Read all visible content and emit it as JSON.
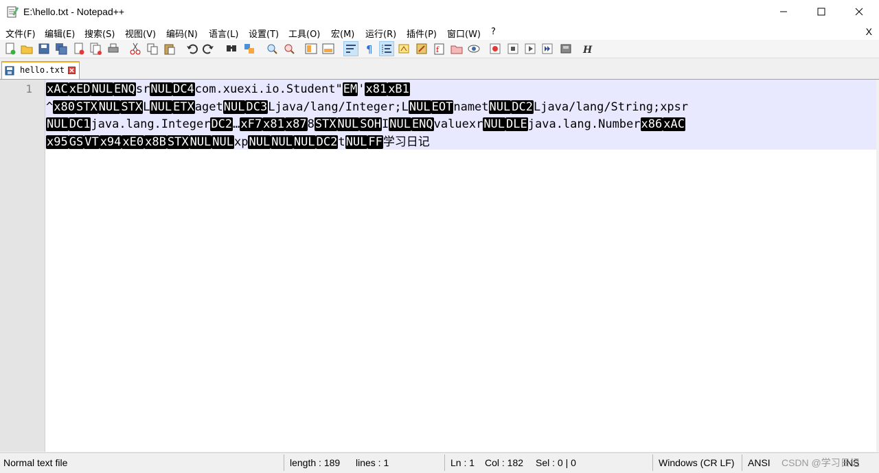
{
  "window": {
    "title": "E:\\hello.txt - Notepad++",
    "close_glyph": "X"
  },
  "menu": [
    "文件(F)",
    "编辑(E)",
    "搜索(S)",
    "视图(V)",
    "编码(N)",
    "语言(L)",
    "设置(T)",
    "工具(O)",
    "宏(M)",
    "运行(R)",
    "插件(P)",
    "窗口(W)",
    "?"
  ],
  "tab": {
    "label": "hello.txt"
  },
  "editor": {
    "line_number": "1",
    "lines": [
      [
        {
          "c": "xAC"
        },
        {
          "c": "xED"
        },
        {
          "c": "NUL"
        },
        {
          "c": "ENQ"
        },
        {
          "t": "sr"
        },
        {
          "c": "NUL"
        },
        {
          "c": "DC4"
        },
        {
          "t": "com.xuexi.io.Student\""
        },
        {
          "c": "EM"
        },
        {
          "t": "'"
        },
        {
          "c": "x81"
        },
        {
          "c": "xB1"
        }
      ],
      [
        {
          "t": "^"
        },
        {
          "c": "x80"
        },
        {
          "c": "STX"
        },
        {
          "c": "NUL"
        },
        {
          "c": "STX"
        },
        {
          "t": "L"
        },
        {
          "c": "NUL"
        },
        {
          "c": "ETX"
        },
        {
          "t": "aget"
        },
        {
          "c": "NUL"
        },
        {
          "c": "DC3"
        },
        {
          "t": "Ljava/lang/Integer;L"
        },
        {
          "c": "NUL"
        },
        {
          "c": "EOT"
        },
        {
          "t": "namet"
        },
        {
          "c": "NUL"
        },
        {
          "c": "DC2"
        },
        {
          "t": "Ljava/lang/String;xpsr"
        }
      ],
      [
        {
          "c": "NUL"
        },
        {
          "c": "DC1"
        },
        {
          "t": "java.lang.Integer"
        },
        {
          "c": "DC2"
        },
        {
          "t": "…"
        },
        {
          "c": "xF7"
        },
        {
          "c": "x81"
        },
        {
          "c": "x87"
        },
        {
          "t": "8"
        },
        {
          "c": "STX"
        },
        {
          "c": "NUL"
        },
        {
          "c": "SOH"
        },
        {
          "t": "I"
        },
        {
          "c": "NUL"
        },
        {
          "c": "ENQ"
        },
        {
          "t": "valuexr"
        },
        {
          "c": "NUL"
        },
        {
          "c": "DLE"
        },
        {
          "t": "java.lang.Number"
        },
        {
          "c": "x86"
        },
        {
          "c": "xAC"
        }
      ],
      [
        {
          "c": "x95"
        },
        {
          "c": "GS"
        },
        {
          "c": "VT"
        },
        {
          "c": "x94"
        },
        {
          "c": "xE0"
        },
        {
          "c": "x8B"
        },
        {
          "c": "STX"
        },
        {
          "c": "NUL"
        },
        {
          "c": "NUL"
        },
        {
          "t": "xp"
        },
        {
          "c": "NUL"
        },
        {
          "c": "NUL"
        },
        {
          "c": "NUL"
        },
        {
          "c": "DC2"
        },
        {
          "t": "t"
        },
        {
          "c": "NUL"
        },
        {
          "c": "FF"
        },
        {
          "t": "学习日记"
        }
      ]
    ]
  },
  "status": {
    "file_type": "Normal text file",
    "length": "length : 189",
    "lines": "lines : 1",
    "ln": "Ln : 1",
    "col": "Col : 182",
    "sel": "Sel : 0 | 0",
    "eol": "Windows (CR LF)",
    "encoding": "ANSI",
    "mode": "INS",
    "watermark": "CSDN @学习日记"
  },
  "icons": {
    "toolbar": [
      "new-file-icon",
      "open-file-icon",
      "save-icon",
      "save-all-icon",
      "close-icon",
      "close-all-icon",
      "print-icon",
      "cut-icon",
      "copy-icon",
      "paste-icon",
      "undo-icon",
      "redo-icon",
      "find-icon",
      "replace-icon",
      "zoom-in-icon",
      "zoom-out-icon",
      "sync-vertical-icon",
      "sync-horizontal-icon",
      "word-wrap-icon",
      "show-all-chars-icon",
      "indent-guide-icon",
      "define-language-icon",
      "doc-map-icon",
      "function-list-icon",
      "folder-workspace-icon",
      "monitoring-icon",
      "record-macro-icon",
      "stop-record-icon",
      "play-macro-icon",
      "run-macro-multiple-icon",
      "save-macro-icon",
      "hex-icon"
    ]
  }
}
